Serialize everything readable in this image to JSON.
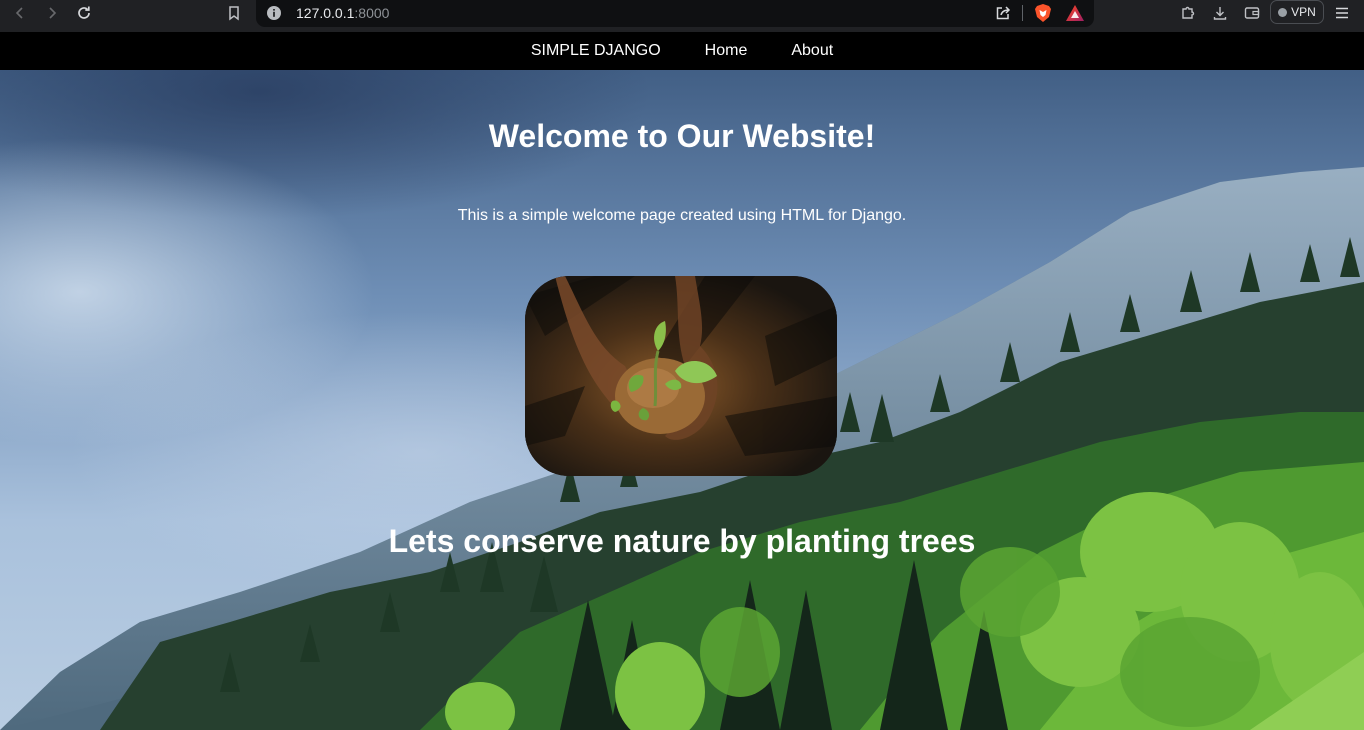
{
  "browser": {
    "url_host": "127.0.0.1",
    "url_port": ":8000",
    "vpn_label": "VPN",
    "icons": [
      "back-icon",
      "forward-icon",
      "reload-icon",
      "bookmark-icon",
      "site-info-icon",
      "share-icon",
      "brave-shields-icon",
      "brave-rewards-icon",
      "extensions-icon",
      "downloads-icon",
      "wallet-icon",
      "menu-icon"
    ]
  },
  "nav": {
    "brand": "SIMPLE DJANGO",
    "items": [
      {
        "label": "Home"
      },
      {
        "label": "About"
      }
    ]
  },
  "main": {
    "title": "Welcome to Our Website!",
    "intro": "This is a simple welcome page created using HTML for Django.",
    "image": "hands-holding-seedling",
    "slogan": "Lets conserve nature by planting trees"
  },
  "colors": {
    "chrome_bg": "#202124",
    "urlbar_bg": "#0f1012",
    "nav_bg": "#000000",
    "text": "#ffffff"
  }
}
